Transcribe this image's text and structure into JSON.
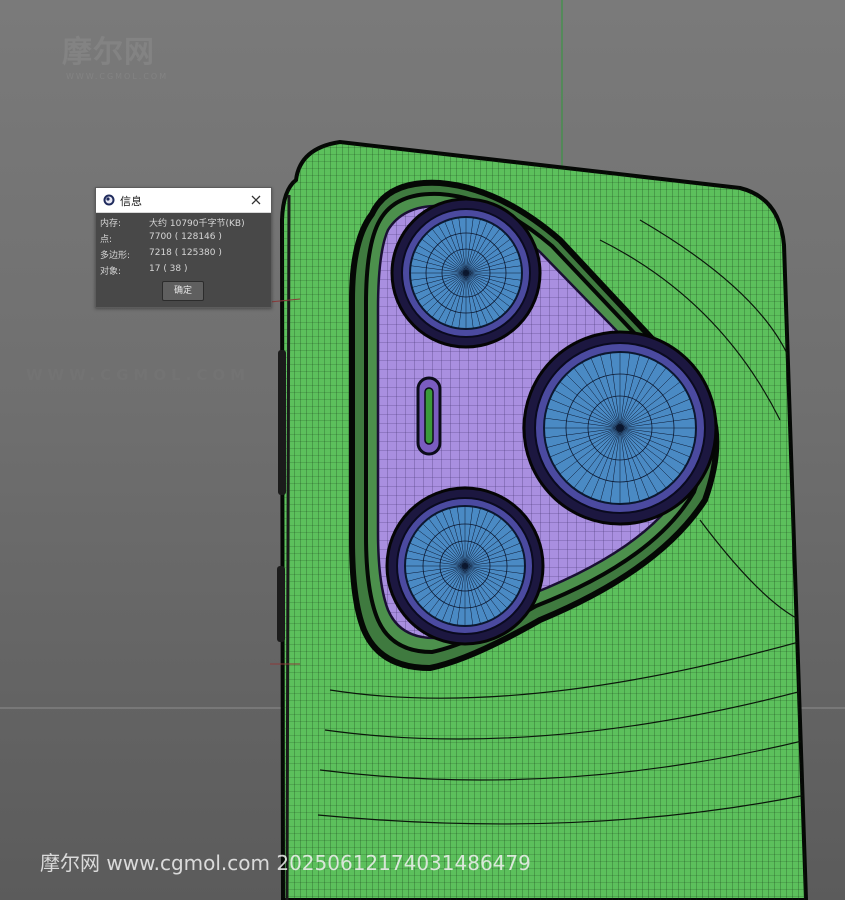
{
  "watermarks": {
    "top_logo": "摩尔网",
    "top_sub": "WWW.CGMOL.COM",
    "middle": "WWW.CGMOL.COM",
    "bottom": "摩尔网 www.cgmol.com 20250612174031486479"
  },
  "dialog": {
    "title": "信息",
    "app_icon": "cinema4d-icon",
    "close_icon": "close-icon",
    "rows": [
      {
        "label": "内存:",
        "value": "大约 10790千字节(KB)"
      },
      {
        "label": "点:",
        "value": "7700 ( 128146 )"
      },
      {
        "label": "多边形:",
        "value": "7218 ( 125380 )"
      },
      {
        "label": "对象:",
        "value": "17 ( 38 )"
      }
    ],
    "ok_label": "确定"
  },
  "colors": {
    "viewport_bg": "#6e6e6e",
    "phone_body": "#5cc05c",
    "camera_plate": "#a98fe0",
    "lens": "#4a8ac4",
    "wire": "#0e1a0e"
  }
}
